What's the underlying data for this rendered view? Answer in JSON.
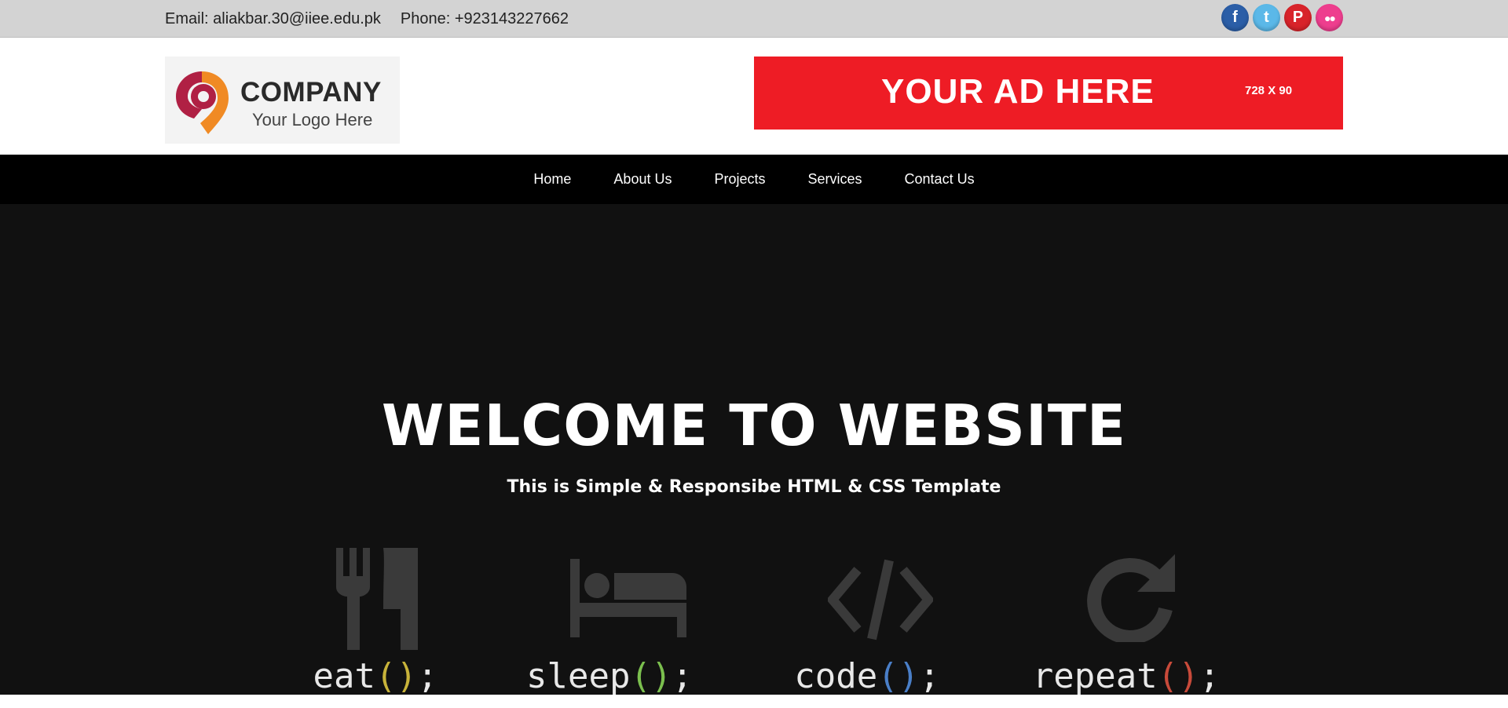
{
  "topbar": {
    "email": "Email: aliakbar.30@iiee.edu.pk",
    "phone": "Phone: +923143227662",
    "social": [
      {
        "name": "facebook-icon",
        "glyph": "f",
        "color": "#2b5ea7"
      },
      {
        "name": "twitter-icon",
        "glyph": "t",
        "color": "#5bb8e8"
      },
      {
        "name": "pinterest-icon",
        "glyph": "P",
        "color": "#d8232a"
      },
      {
        "name": "flickr-icon",
        "glyph": "••",
        "color": "#ee3e8e"
      }
    ]
  },
  "header": {
    "logo_company": "COMPANY",
    "logo_tagline": "Your Logo Here",
    "ad_text": "YOUR AD HERE",
    "ad_size": "728 X 90",
    "ad_color": "#ee1c25"
  },
  "nav": {
    "items": [
      "Home",
      "About Us",
      "Projects",
      "Services",
      "Contact Us"
    ]
  },
  "hero": {
    "title": "WELCOME TO WEBSITE",
    "subtitle": "This is Simple & Responsibe HTML & CSS Template",
    "motto": [
      {
        "icon": "fork-knife-icon",
        "word": "eat",
        "paren_color": "#c8b33a"
      },
      {
        "icon": "bed-icon",
        "word": "sleep",
        "paren_color": "#7bbf4e"
      },
      {
        "icon": "code-icon",
        "word": "code",
        "paren_color": "#4a7fc8"
      },
      {
        "icon": "refresh-icon",
        "word": "repeat",
        "paren_color": "#c84a3a"
      }
    ]
  }
}
